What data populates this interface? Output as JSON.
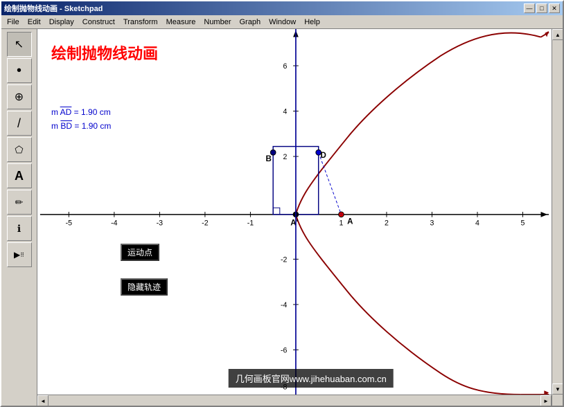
{
  "titlebar": {
    "title": "绘制抛物线动画 - Sketchpad",
    "minimize": "—",
    "maximize": "□",
    "close": "✕"
  },
  "menubar": {
    "items": [
      "File",
      "Edit",
      "Display",
      "Construct",
      "Transform",
      "Measure",
      "Number",
      "Graph",
      "Window",
      "Help"
    ]
  },
  "toolbar": {
    "tools": [
      {
        "name": "select",
        "symbol": "↖",
        "active": true
      },
      {
        "name": "point",
        "symbol": "•"
      },
      {
        "name": "compass",
        "symbol": "⊕"
      },
      {
        "name": "straightedge",
        "symbol": "/"
      },
      {
        "name": "polygon",
        "symbol": "⬠"
      },
      {
        "name": "text",
        "symbol": "A"
      },
      {
        "name": "custom",
        "symbol": "✏"
      },
      {
        "name": "info",
        "symbol": "ℹ"
      },
      {
        "name": "hand",
        "symbol": "▶"
      }
    ]
  },
  "canvas": {
    "title": "绘制抛物线动画",
    "measurement1_label": "m AD",
    "measurement1_value": "= 1.90 cm",
    "measurement2_label": "m BD",
    "measurement2_value": "= 1.90 cm",
    "button1": "运动点",
    "button2": "隐藏轨迹",
    "watermark": "几何画板官网www.jihehuaban.com.cn"
  },
  "colors": {
    "accent": "#cc0000",
    "blue": "#0000cc",
    "axis": "#000000",
    "curve": "#8b0000",
    "rect_stroke": "#000080"
  }
}
